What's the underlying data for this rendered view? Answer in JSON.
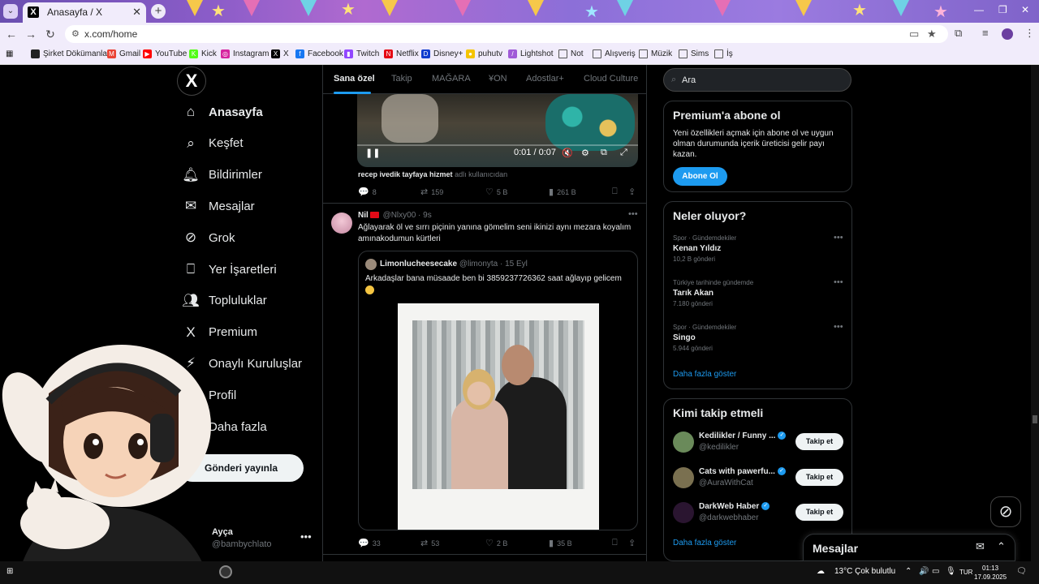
{
  "browser": {
    "tab_title": "Anasayfa / X",
    "url": "x.com/home",
    "bookmarks": [
      {
        "label": "Şirket Dökümanları",
        "color": "#222222"
      },
      {
        "label": "Gmail",
        "color": "#ea4335"
      },
      {
        "label": "YouTube",
        "color": "#ff0000"
      },
      {
        "label": "Kick",
        "color": "#53fc18"
      },
      {
        "label": "Instagram",
        "color": "#d6249f"
      },
      {
        "label": "X",
        "color": "#000000"
      },
      {
        "label": "Facebook",
        "color": "#1877f2"
      },
      {
        "label": "Twitch",
        "color": "#9146ff"
      },
      {
        "label": "Netflix",
        "color": "#e50914"
      },
      {
        "label": "Disney+",
        "color": "#113ccf"
      },
      {
        "label": "puhutv",
        "color": "#f5c400"
      },
      {
        "label": "Lightshot",
        "color": "#a05ad8"
      },
      {
        "label": "Not",
        "color": "folder"
      },
      {
        "label": "Alışveriş",
        "color": "folder"
      },
      {
        "label": "Müzik",
        "color": "folder"
      },
      {
        "label": "Sims",
        "color": "folder"
      },
      {
        "label": "İş",
        "color": "folder"
      }
    ]
  },
  "nav": {
    "items": [
      {
        "label": "Anasayfa",
        "icon": "home-icon"
      },
      {
        "label": "Keşfet",
        "icon": "search-icon"
      },
      {
        "label": "Bildirimler",
        "icon": "bell-icon"
      },
      {
        "label": "Mesajlar",
        "icon": "mail-icon"
      },
      {
        "label": "Grok",
        "icon": "grok-icon"
      },
      {
        "label": "Yer İşaretleri",
        "icon": "bookmark-icon"
      },
      {
        "label": "Topluluklar",
        "icon": "communities-icon"
      },
      {
        "label": "Premium",
        "icon": "x-icon"
      },
      {
        "label": "Onaylı Kuruluşlar",
        "icon": "lightning-icon"
      },
      {
        "label": "Profil",
        "icon": "person-icon"
      },
      {
        "label": "Daha fazla",
        "icon": "more-circle-icon"
      }
    ],
    "post_button": "Gönderi yayınla",
    "account_name": "Ayça",
    "account_handle": "@bambychlato"
  },
  "timeline": {
    "tabs": [
      "Sana özel",
      "Takip",
      "MAĞARA",
      "¥ON",
      "Adostlar+",
      "Cloud Culture"
    ],
    "tweet1": {
      "video_time": "0:01 / 0:07",
      "attribution_name": "recep ivedik tayfaya hizmet",
      "attribution_suffix": "adlı kullanıcıdan",
      "replies": "8",
      "reposts": "159",
      "likes": "5 B",
      "views": "261 B"
    },
    "tweet2": {
      "name": "Nil",
      "handle": "@Nlxy00 · 9s",
      "text": "Ağlayarak öl ve sırrı piçinin yanına gömelim seni ikinizi aynı mezara koyalım amınakodumun kürtleri",
      "quote": {
        "name": "Limonlucheesecake",
        "handle": "@limonyta · 15 Eyl",
        "text": "Arkadaşlar bana müsaade ben bi 3859237726362 saat ağlayıp gelicem"
      },
      "replies": "33",
      "reposts": "53",
      "likes": "2 B",
      "views": "35 B"
    }
  },
  "sidebar": {
    "search_placeholder": "Ara",
    "premium": {
      "title": "Premium'a abone ol",
      "text": "Yeni özellikleri açmak için abone ol ve uygun olman durumunda içerik üreticisi gelir payı kazan.",
      "button": "Abone Ol"
    },
    "trends": {
      "title": "Neler oluyor?",
      "items": [
        {
          "category": "Spor · Gündemdekiler",
          "topic": "Kenan Yıldız",
          "count": "10,2 B gönderi"
        },
        {
          "category": "Türkiye tarihinde gündemde",
          "topic": "Tarık Akan",
          "count": "7.180 gönderi"
        },
        {
          "category": "Spor · Gündemdekiler",
          "topic": "Singo",
          "count": "5.944 gönderi"
        }
      ],
      "show_more": "Daha fazla göster"
    },
    "who_to_follow": {
      "title": "Kimi takip etmeli",
      "items": [
        {
          "name": "Kedilikler / Funny ...",
          "handle": "@kedilikler",
          "button": "Takip et"
        },
        {
          "name": "Cats with pawerfu...",
          "handle": "@AuraWithCat",
          "button": "Takip et"
        },
        {
          "name": "DarkWeb Haber",
          "handle": "@darkwebhaber",
          "button": "Takip et"
        }
      ],
      "show_more": "Daha fazla göster"
    },
    "messages_drawer": "Mesajlar"
  },
  "taskbar": {
    "weather": "13°C  Çok bulutlu",
    "lang": "TUR",
    "time": "01:13",
    "date": "17.09.2025"
  }
}
